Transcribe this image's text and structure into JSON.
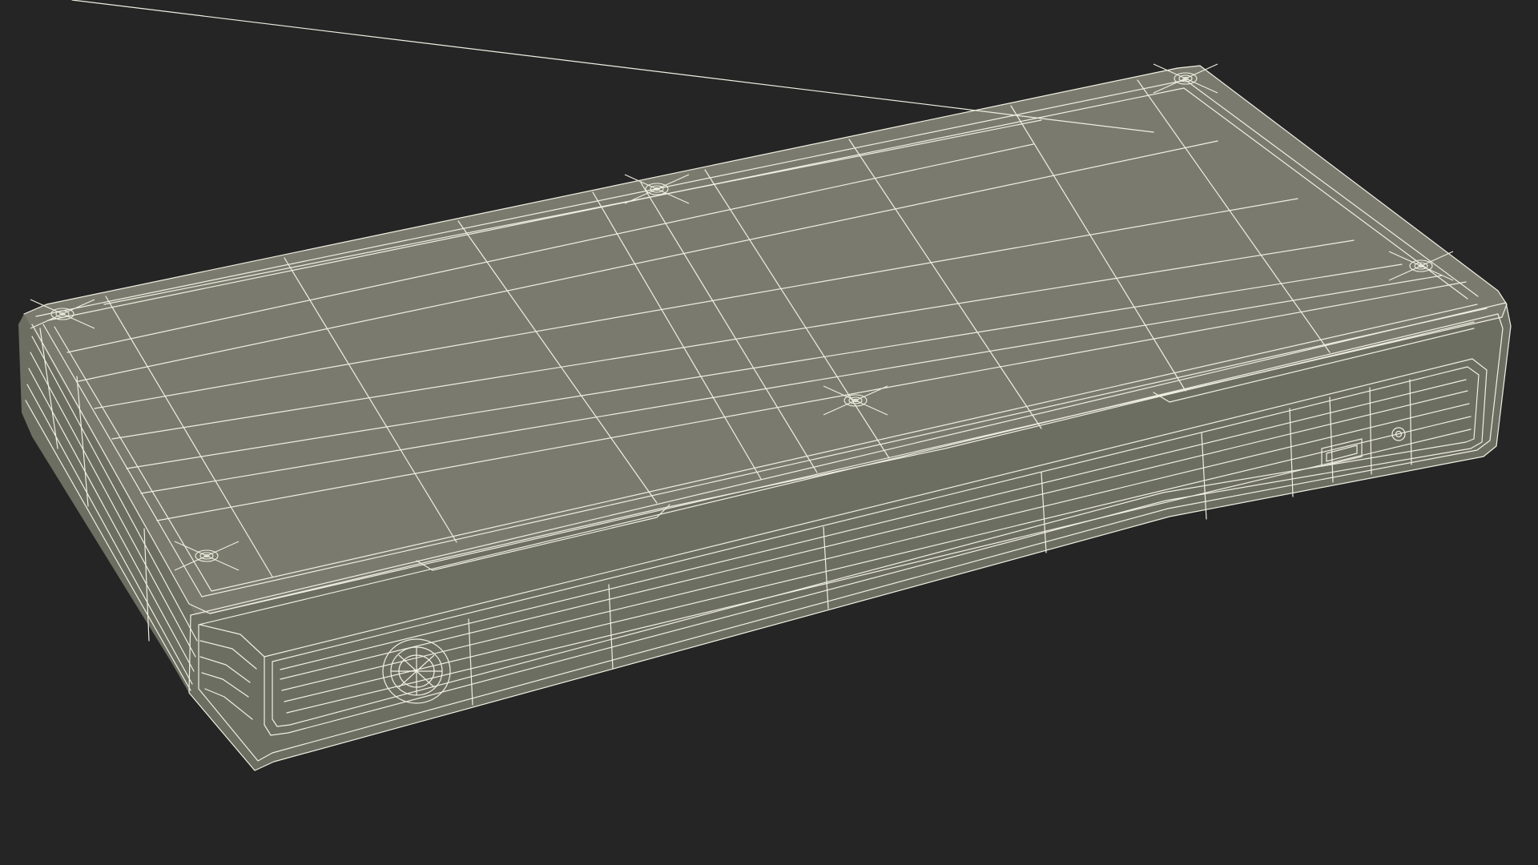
{
  "scene": {
    "subject": "",
    "background_color": "#252525",
    "surface_color": "#7a7b6e",
    "surface_shadow_color": "#6d6e62",
    "wire_color": "#efefe2",
    "screw_count": 6,
    "usb_port_count": 1,
    "audio_jack_count": 1,
    "front_button_count": 1
  }
}
